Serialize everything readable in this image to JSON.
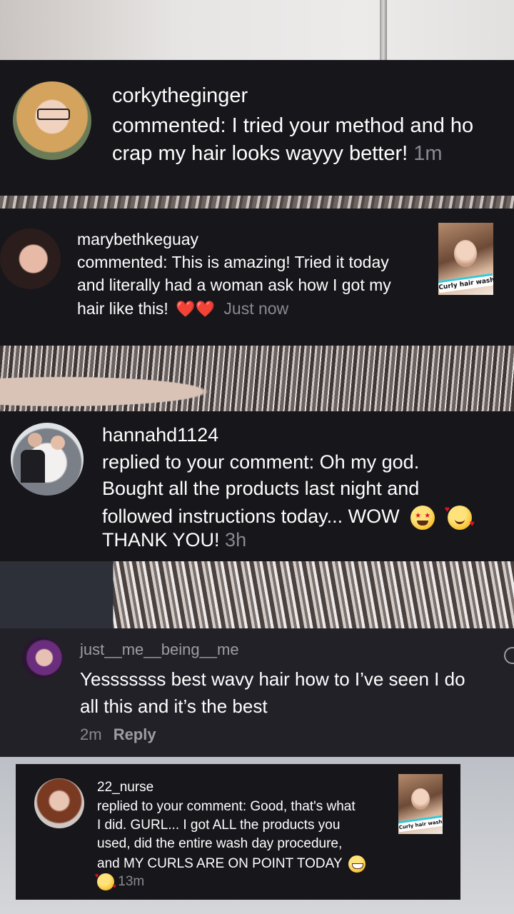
{
  "notifications": [
    {
      "username": "corkytheginger",
      "text": "commented: I tried your method and ho crap my hair looks wayyy better!",
      "time": "1m"
    },
    {
      "username": "marybethkeguay",
      "text_line1": "commented: This is amazing! Tried it today",
      "text_line2": "and literally had a woman ask how I got my",
      "text_line3": "hair like this!",
      "hearts": "❤️❤️",
      "time": "Just now",
      "thumb_label": "Curly hair wash"
    },
    {
      "username": "hannahd1124",
      "text_line1": "replied to your comment: Oh my god.",
      "text_line2": "Bought all the products last night and",
      "text_line3": "followed instructions today... WOW",
      "text_line4": "THANK YOU!",
      "time": "3h"
    },
    {
      "username": "just__me__being__me",
      "text": "Yesssssss best wavy hair how to I’ve seen I do all this and it’s the best",
      "time": "2m",
      "reply_label": "Reply"
    },
    {
      "username": "22_nurse",
      "text_line1": "replied to your comment: Good, that's what",
      "text_line2": "I did. GURL... I got ALL the products you",
      "text_line3": "used, did the entire wash day procedure,",
      "text_line4": "and MY CURLS ARE ON POINT TODAY",
      "time": "13m",
      "thumb_label": "Curly hair wash"
    }
  ],
  "colors": {
    "card_bg": "#17161b",
    "text": "#ffffff",
    "muted": "#8a8990"
  }
}
